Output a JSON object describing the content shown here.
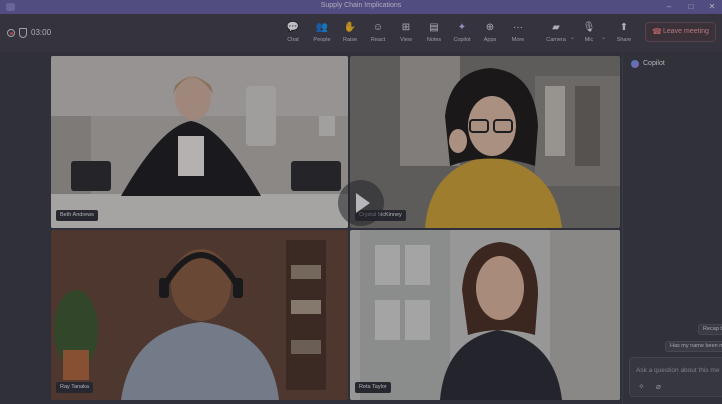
{
  "window": {
    "title": "Supply Chain Implications"
  },
  "toolbar": {
    "timer": "03:00",
    "tools": [
      {
        "label": "Chat",
        "glyph": "💬"
      },
      {
        "label": "People",
        "glyph": "👥"
      },
      {
        "label": "Raise",
        "glyph": "✋"
      },
      {
        "label": "React",
        "glyph": "☺"
      },
      {
        "label": "View",
        "glyph": "⊞"
      },
      {
        "label": "Notes",
        "glyph": "▤"
      },
      {
        "label": "Copilot",
        "glyph": "✦"
      },
      {
        "label": "Apps",
        "glyph": "⊕"
      },
      {
        "label": "More",
        "glyph": "···"
      },
      {
        "label": "Camera",
        "glyph": "▰"
      },
      {
        "label": "Mic",
        "glyph": "🎙"
      },
      {
        "label": "Share",
        "glyph": "⬆"
      }
    ],
    "leave_label": "Leave meeting"
  },
  "participants": [
    {
      "name": "Beth Andrews"
    },
    {
      "name": "Crystal McKinney"
    },
    {
      "name": "Ray Tanaka"
    },
    {
      "name": "Reta Taylor"
    }
  ],
  "copilot": {
    "title": "Copilot",
    "suggestions": [
      "Recap th",
      "Has my name been m"
    ],
    "input_placeholder": "Ask a question about this me"
  },
  "colors": {
    "titlebar": "#6a63a8",
    "toolbar": "#403f4c",
    "leave": "#f07c82"
  }
}
